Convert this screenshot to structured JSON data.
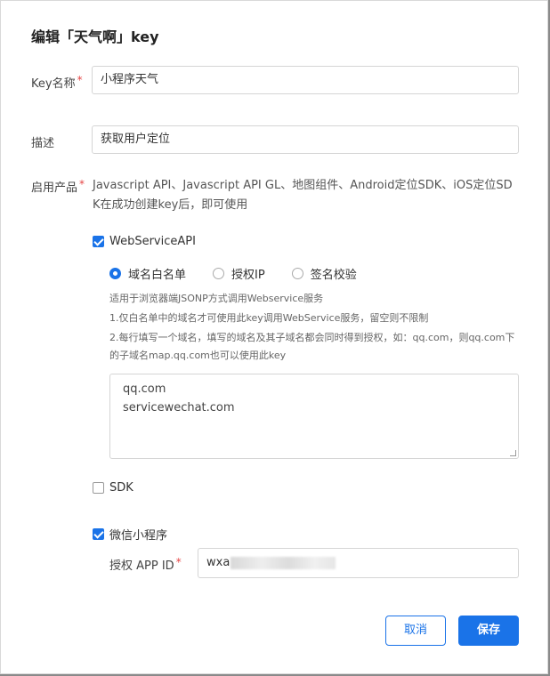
{
  "dialog": {
    "title": "编辑「天气啊」key"
  },
  "form": {
    "key_name": {
      "label": "Key名称",
      "required_mark": "*",
      "value": "小程序天气"
    },
    "description": {
      "label": "描述",
      "value": "获取用户定位"
    },
    "products": {
      "label": "启用产品",
      "required_mark": "*",
      "text": "Javascript API、Javascript API GL、地图组件、Android定位SDK、iOS定位SDK在成功创建key后，即可使用"
    },
    "webservice": {
      "label": "WebServiceAPI",
      "checked": true,
      "radio_options": [
        {
          "label": "域名白名单",
          "selected": true
        },
        {
          "label": "授权IP",
          "selected": false
        },
        {
          "label": "签名校验",
          "selected": false
        }
      ],
      "hints": [
        "适用于浏览器端JSONP方式调用Webservice服务",
        "1.仅白名单中的域名才可使用此key调用WebService服务，留空则不限制",
        "2.每行填写一个域名，填写的域名及其子域名都会同时得到授权，如：qq.com，则qq.com下的子域名map.qq.com也可以使用此key"
      ],
      "domains": [
        "qq.com",
        "servicewechat.com"
      ]
    },
    "sdk": {
      "label": "SDK",
      "checked": false
    },
    "miniprogram": {
      "label": "微信小程序",
      "checked": true,
      "appid_label": "授权 APP ID",
      "required_mark": "*",
      "appid_value": "wxa"
    }
  },
  "buttons": {
    "cancel": "取消",
    "save": "保存"
  },
  "colors": {
    "accent": "#1a73e8",
    "required": "#e54545"
  }
}
